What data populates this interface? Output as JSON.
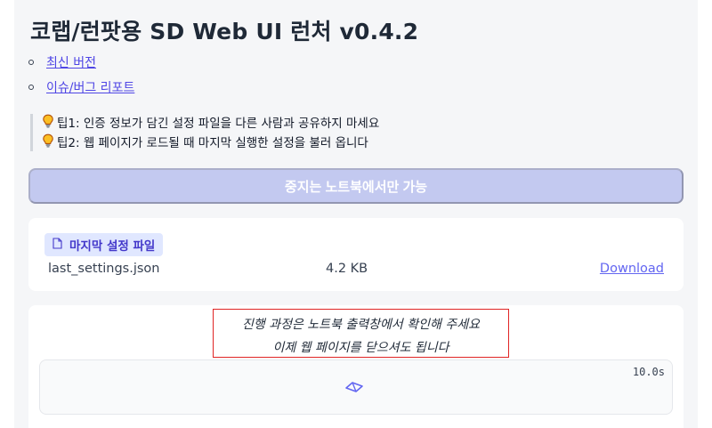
{
  "header": {
    "title": "코랩/런팟용 SD Web UI 런처 v0.4.2"
  },
  "links": [
    {
      "label": "최신 버전"
    },
    {
      "label": "이슈/버그 리포트"
    }
  ],
  "tips": [
    {
      "text": "팁1: 인증 정보가 담긴 설정 파일을 다른 사람과 공유하지 마세요",
      "icon": "lightbulb-icon"
    },
    {
      "text": "팁2: 웹 페이지가 로드될 때 마지막 실행한 설정을 불러 옵니다",
      "icon": "lightbulb-icon"
    }
  ],
  "stop_button": {
    "label": "중지는 노트북에서만 가능",
    "state": "disabled"
  },
  "file_panel": {
    "label": "마지막 설정 파일",
    "label_icon": "file-icon",
    "file_name": "last_settings.json",
    "file_size": "4.2 KB",
    "download_label": "Download"
  },
  "progress": {
    "status_lines": [
      "진행 과정은 노트북 출력창에서 확인해 주세요",
      "이제 웹 페이지를 닫으셔도 됩니다"
    ],
    "timer": "10.0s",
    "loader_icon": "loading-spinner-icon"
  },
  "colors": {
    "accent": "#6366f1",
    "button_disabled": "#c3c9f0",
    "label_bg": "#e0e7ff",
    "highlight_border": "#e02424",
    "tip_icon": "#f59e0b"
  }
}
